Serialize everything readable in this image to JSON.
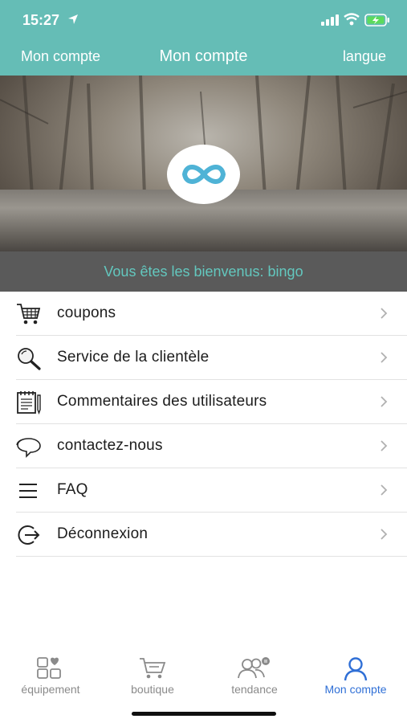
{
  "status_bar": {
    "time": "15:27"
  },
  "nav": {
    "back_label": "Mon compte",
    "title": "Mon compte",
    "right_label": "langue"
  },
  "welcome": {
    "text": "Vous êtes les bienvenus: bingo"
  },
  "menu": {
    "items": [
      {
        "label": "coupons",
        "icon": "cart-icon"
      },
      {
        "label": "Service de la clientèle",
        "icon": "magnifier-icon"
      },
      {
        "label": "Commentaires des utilisateurs",
        "icon": "notepad-icon"
      },
      {
        "label": "contactez-nous",
        "icon": "chat-bubbles-icon"
      },
      {
        "label": "FAQ",
        "icon": "list-icon"
      },
      {
        "label": "Déconnexion",
        "icon": "logout-icon"
      }
    ]
  },
  "tabs": [
    {
      "label": "équipement",
      "icon": "grid-icon",
      "active": false
    },
    {
      "label": "boutique",
      "icon": "cart-icon",
      "active": false
    },
    {
      "label": "tendance",
      "icon": "people-icon",
      "active": false
    },
    {
      "label": "Mon compte",
      "icon": "person-icon",
      "active": true
    }
  ],
  "colors": {
    "header": "#65bdb6",
    "welcome_bg": "#5a5a5a",
    "welcome_text": "#63c7be",
    "active_tab": "#2f6fd6",
    "inactive_tab": "#8a8a8a",
    "logo": "#4fb3d6"
  }
}
